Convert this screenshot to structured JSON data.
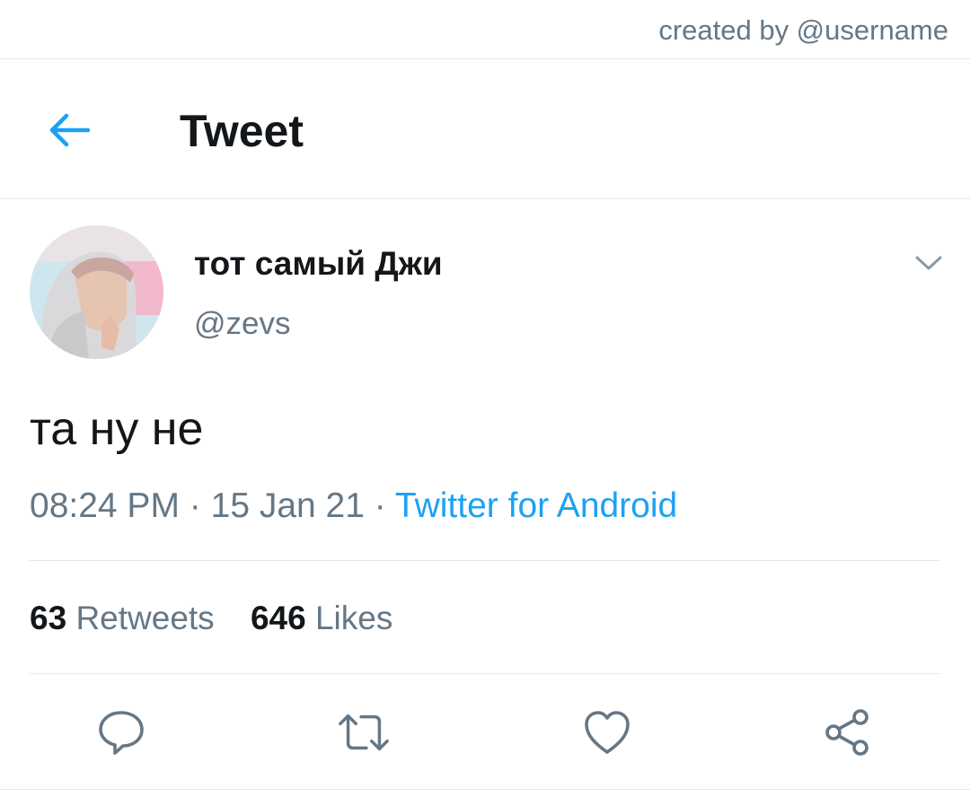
{
  "credit": {
    "text": "created by @username"
  },
  "header": {
    "title": "Tweet",
    "back_icon": "arrow-left-icon"
  },
  "tweet": {
    "author": {
      "display_name": "тот самый Джи",
      "handle": "@zevs"
    },
    "text": "та ну не",
    "time": "08:24 PM",
    "date": "15 Jan 21",
    "separator": "·",
    "source": "Twitter for Android",
    "stats": {
      "retweets_count": "63",
      "retweets_label": "Retweets",
      "likes_count": "646",
      "likes_label": "Likes"
    }
  },
  "actions": [
    "reply-icon",
    "retweet-icon",
    "like-icon",
    "share-icon"
  ],
  "colors": {
    "accent": "#1da1f2",
    "secondary_text": "#657786",
    "primary_text": "#14171a",
    "divider": "#e1e8ed",
    "icon": "#657786"
  }
}
